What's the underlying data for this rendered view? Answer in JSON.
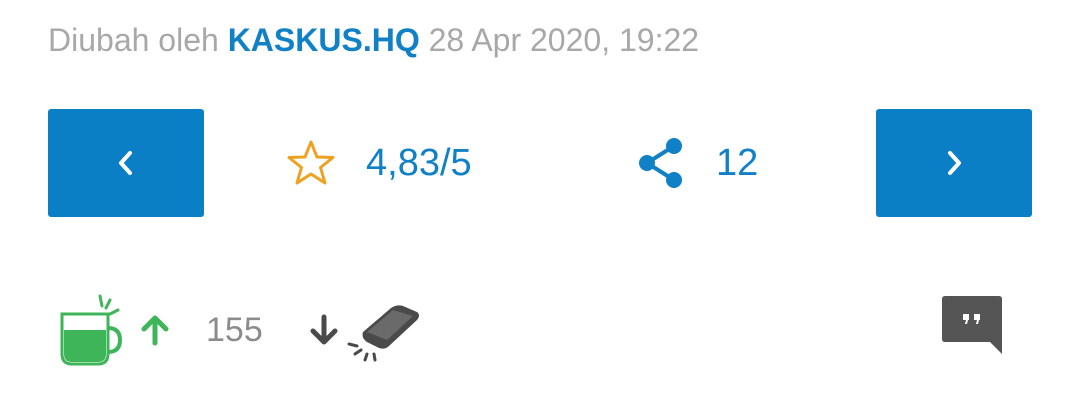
{
  "edited": {
    "prefix": "Diubah oleh",
    "author": "KASKUS.HQ",
    "timestamp": "28 Apr 2020, 19:22"
  },
  "navigation": {
    "prev_icon": "chevron-left-icon",
    "next_icon": "chevron-right-icon"
  },
  "rating": {
    "icon": "star-outline-icon",
    "value": "4,83/5"
  },
  "share": {
    "icon": "share-icon",
    "count": "12"
  },
  "vote": {
    "cendol_icon": "cendol-cup-icon",
    "upvote_icon": "arrow-up-icon",
    "count": "155",
    "downvote_icon": "arrow-down-icon",
    "bata_icon": "brick-icon"
  },
  "quote": {
    "icon": "quote-bubble-icon"
  },
  "colors": {
    "accent_blue": "#0a7fc6",
    "link_blue": "#1081c6",
    "muted_gray": "#a8a8a8",
    "star_orange": "#f0a020",
    "cendol_green": "#3fb55a",
    "dark_gray": "#4a4a4a"
  }
}
